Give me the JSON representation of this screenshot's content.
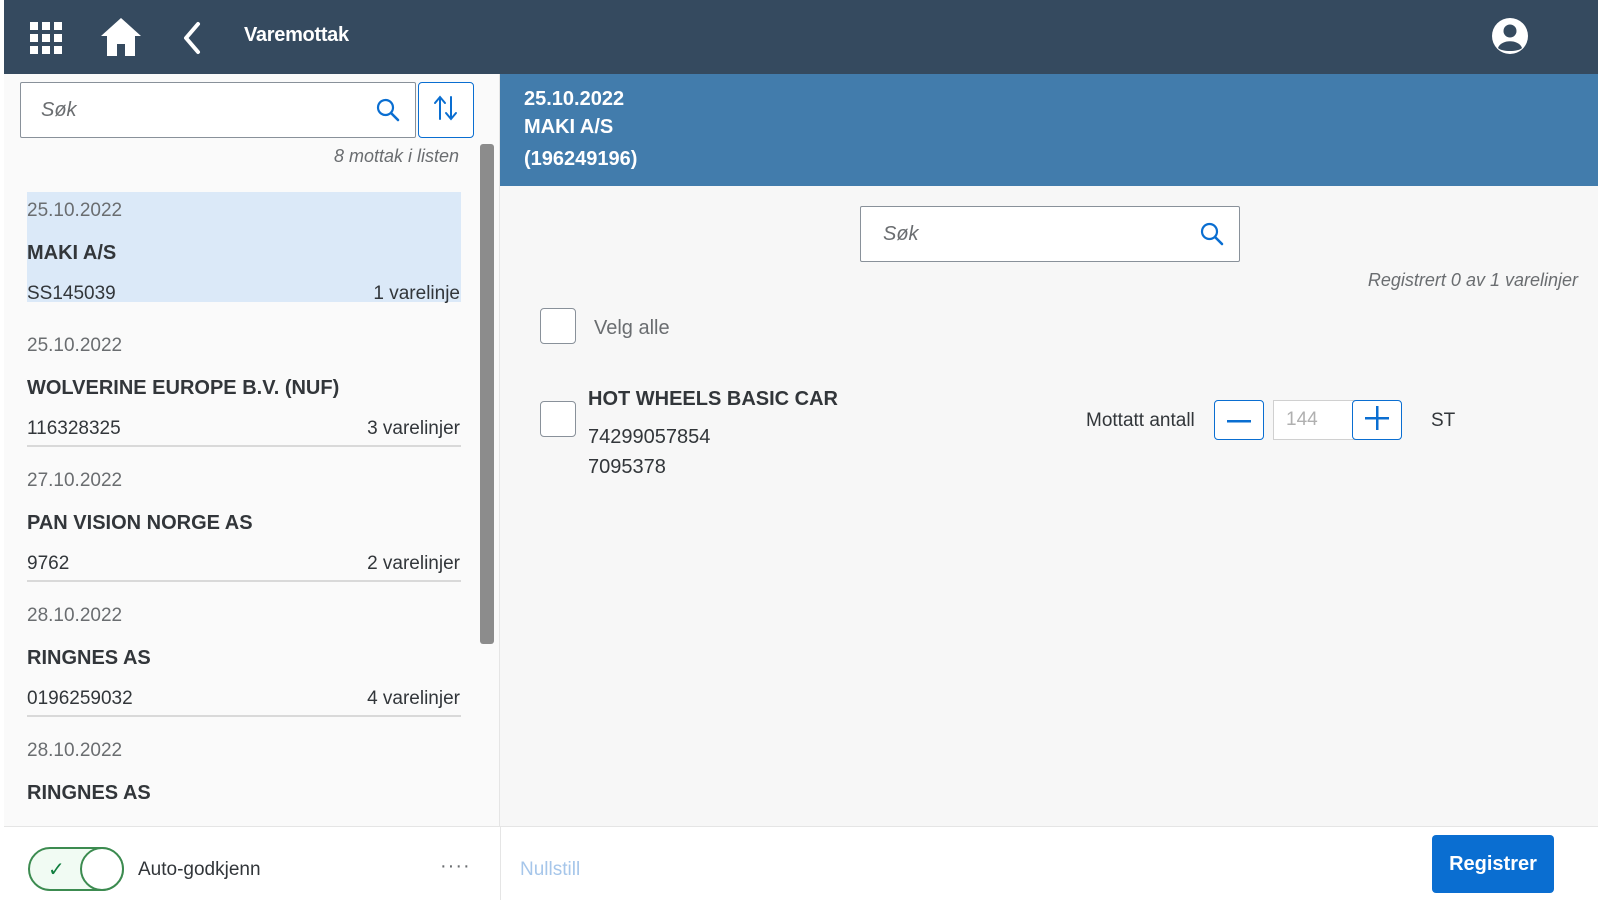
{
  "shell": {
    "title": "Varemottak"
  },
  "master": {
    "search_placeholder": "Søk",
    "count_text": "8 mottak i listen",
    "items": [
      {
        "date": "25.10.2022",
        "name": "MAKI A/S",
        "number": "SS145039",
        "lines": "1 varelinje"
      },
      {
        "date": "25.10.2022",
        "name": "WOLVERINE EUROPE B.V. (NUF)",
        "number": "116328325",
        "lines": "3 varelinjer"
      },
      {
        "date": "27.10.2022",
        "name": "PAN VISION NORGE AS",
        "number": "9762",
        "lines": "2 varelinjer"
      },
      {
        "date": "28.10.2022",
        "name": "RINGNES AS",
        "number": "0196259032",
        "lines": "4 varelinjer"
      },
      {
        "date": "28.10.2022",
        "name": "RINGNES AS",
        "number": "",
        "lines": ""
      }
    ]
  },
  "detail": {
    "header": {
      "date": "25.10.2022",
      "supplier": "MAKI A/S",
      "reference": "(196249196)"
    },
    "search_placeholder": "Søk",
    "registered_text": "Registrert 0 av 1 varelinjer",
    "select_all_label": "Velg alle",
    "product": {
      "name": "HOT WHEELS BASIC CAR",
      "ean": "74299057854",
      "article": "7095378",
      "qty_label": "Mottatt antall",
      "qty_value": "144",
      "unit": "ST"
    }
  },
  "footer": {
    "toggle_label": "Auto-godkjenn",
    "more_label": "····",
    "reset_label": "Nullstill",
    "register_label": "Registrer"
  },
  "colors": {
    "shell": "#354a5f",
    "object_header": "#427cac",
    "accent": "#0a6ed1",
    "selected_row": "#dbe9f8",
    "toggle_green": "#3c8b50"
  }
}
